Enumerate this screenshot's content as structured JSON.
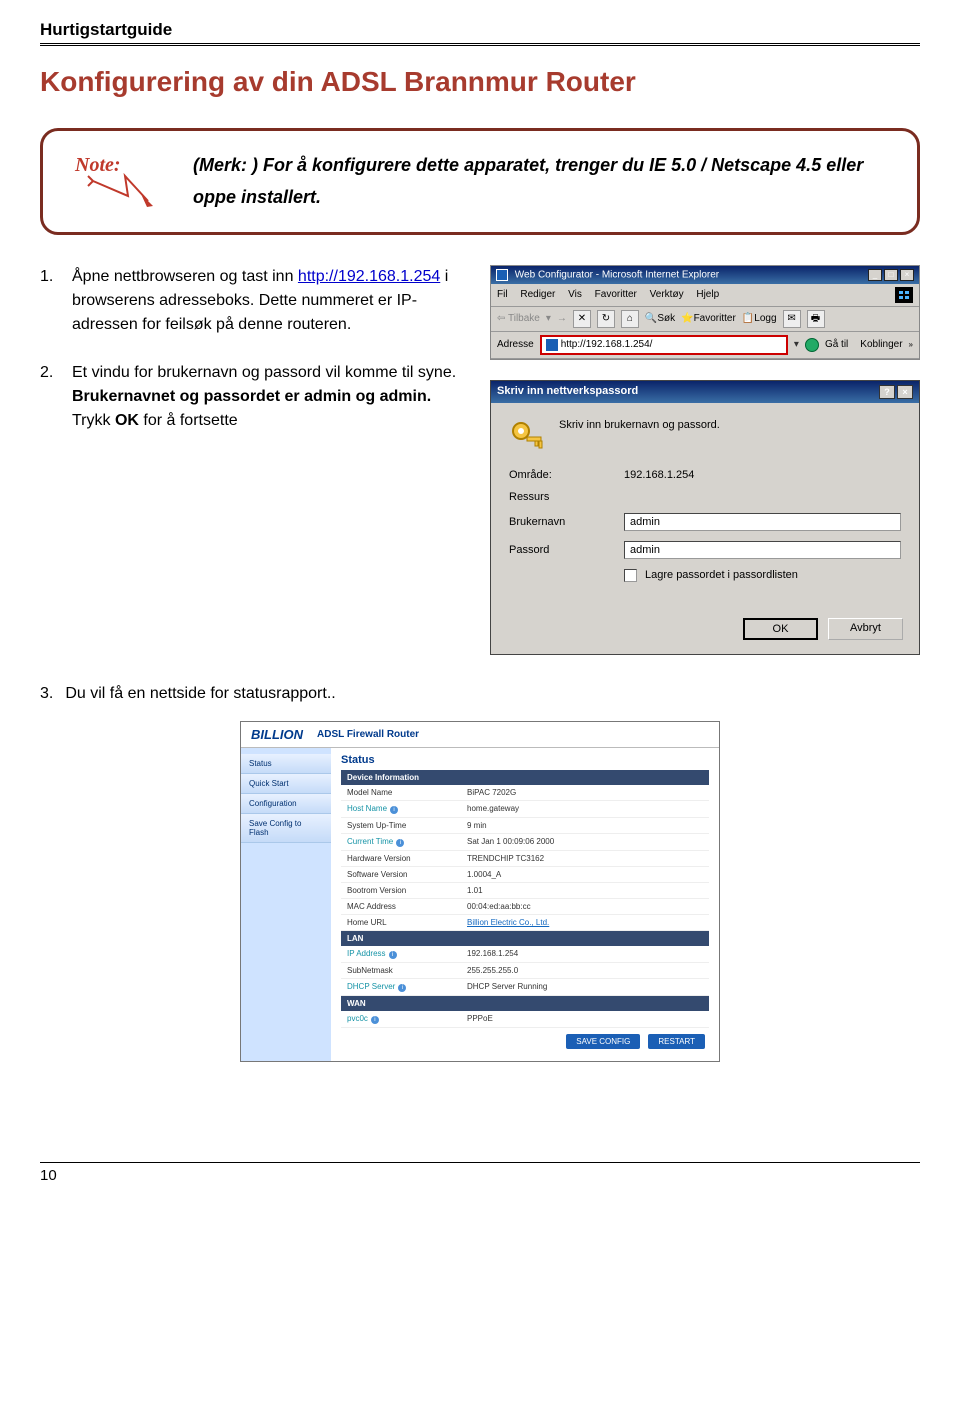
{
  "doc_header": "Hurtigstartguide",
  "page_title": "Konfigurering av din ADSL Brannmur Router",
  "note": {
    "label_prefix": "(Merk: )",
    "text": "For å konfigurere dette apparatet, trenger du IE 5.0 / Netscape 4.5 eller oppe installert."
  },
  "steps": {
    "s1_num": "1.",
    "s1_a": "Åpne nettbrowseren og tast inn ",
    "s1_link": "http://192.168.1.254",
    "s1_b": " i browserens adresseboks.   Dette nummeret er IP-adressen for feilsøk på denne routeren.",
    "s2_num": "2.",
    "s2_a": "Et vindu for brukernavn og passord vil komme til syne.   ",
    "s2_bold": "Brukernavnet og passordet er admin og admin.",
    "s2_b": "   Trykk ",
    "s2_bold2": "OK",
    "s2_c": " for å fortsette",
    "s3_num": "3.",
    "s3_text": "Du vil få en nettside for statusrapport.."
  },
  "ie": {
    "title": "Web Configurator - Microsoft Internet Explorer",
    "m_fil": "Fil",
    "m_red": "Rediger",
    "m_vis": "Vis",
    "m_fav": "Favoritter",
    "m_ver": "Verktøy",
    "m_hje": "Hjelp",
    "tb_back": "Tilbake",
    "tb_sok": "Søk",
    "tb_fav": "Favoritter",
    "tb_logg": "Logg",
    "addr_label": "Adresse",
    "addr_value": "http://192.168.1.254/",
    "go": "Gå til",
    "koblinger": "Koblinger"
  },
  "dialog": {
    "title": "Skriv inn nettverkspassord",
    "desc": "Skriv inn brukernavn og passord.",
    "omrade_l": "Område:",
    "omrade_v": "192.168.1.254",
    "ressurs_l": "Ressurs",
    "bruker_l": "Brukernavn",
    "bruker_v": "admin",
    "pass_l": "Passord",
    "pass_v": "admin",
    "check": "Lagre passordet i passordlisten",
    "ok": "OK",
    "cancel": "Avbryt"
  },
  "status": {
    "brand": "BILLION",
    "product": "ADSL Firewall Router",
    "side": [
      "Status",
      "Quick Start",
      "Configuration",
      "Save Config to Flash"
    ],
    "heading": "Status",
    "sec_device": "Device Information",
    "rows_device": [
      {
        "k": "Model Name",
        "v": "BiPAC 7202G"
      },
      {
        "k": "Host Name",
        "v": "home.gateway",
        "teal": true,
        "info": true
      },
      {
        "k": "System Up-Time",
        "v": "9 min"
      },
      {
        "k": "Current Time",
        "v": "Sat Jan 1 00:09:06 2000",
        "teal": true,
        "info": true
      },
      {
        "k": "Hardware Version",
        "v": "TRENDCHIP TC3162"
      },
      {
        "k": "Software Version",
        "v": "1.0004_A"
      },
      {
        "k": "Bootrom Version",
        "v": "1.01"
      },
      {
        "k": "MAC Address",
        "v": "00:04:ed:aa:bb:cc"
      },
      {
        "k": "Home URL",
        "v": "Billion Electric Co., Ltd.",
        "link": true
      }
    ],
    "sec_lan": "LAN",
    "rows_lan": [
      {
        "k": "IP Address",
        "v": "192.168.1.254",
        "teal": true,
        "info": true
      },
      {
        "k": "SubNetmask",
        "v": "255.255.255.0"
      },
      {
        "k": "DHCP Server",
        "v": "DHCP Server Running",
        "teal": true,
        "info": true
      }
    ],
    "sec_wan": "WAN",
    "rows_wan": [
      {
        "k": "pvc0c",
        "v": "PPPoE",
        "teal": true,
        "info": true
      }
    ],
    "btn_save": "SAVE CONFIG",
    "btn_restart": "RESTART"
  },
  "page_number": "10"
}
